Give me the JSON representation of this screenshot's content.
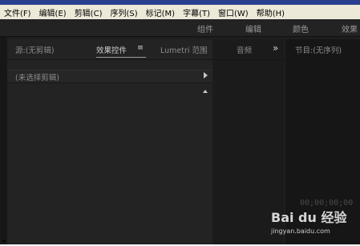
{
  "menu": {
    "items": [
      "文件(F)",
      "编辑(E)",
      "剪辑(C)",
      "序列(S)",
      "标记(M)",
      "字幕(T)",
      "窗口(W)",
      "帮助(H)"
    ]
  },
  "workspace_tabs": [
    "组件",
    "编辑",
    "颜色",
    "效果"
  ],
  "left_panel": {
    "tabs": [
      "源:(无剪辑)",
      "效果控件",
      "Lumetri 范围",
      "音频"
    ],
    "active_tab": "效果控件",
    "menu_glyph": "≡",
    "overflow_glyph": "»",
    "clip_placeholder": "(未选择剪辑)"
  },
  "program_panel": {
    "tab": "节目:(无序列)",
    "timecode": "00;00;00;00"
  },
  "watermark": {
    "logo_text": "Bai du 经验",
    "url": "jingyan.baidu.com"
  },
  "colors": {
    "background": "#1e1e1e",
    "menubar": "#ece9d8",
    "titlebar": "#2a3f8f"
  }
}
